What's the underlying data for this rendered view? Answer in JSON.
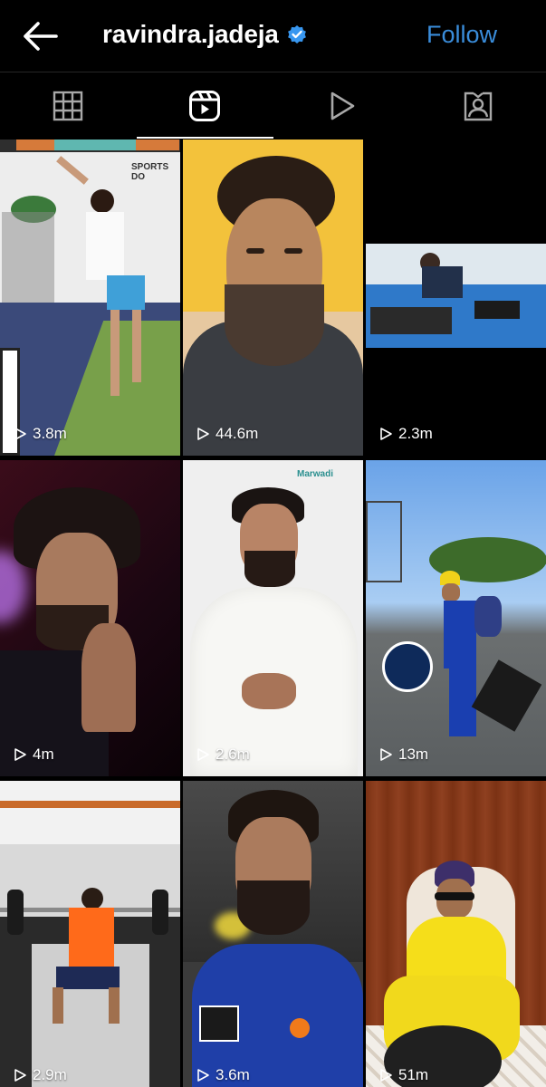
{
  "header": {
    "username": "ravindra.jadeja",
    "follow_label": "Follow",
    "back_icon": "arrow-left-icon",
    "verified_icon": "verified-badge-icon",
    "verified_color": "#3897f0",
    "follow_color": "#3a8ddb"
  },
  "tabs": [
    {
      "name": "grid",
      "icon": "grid-icon",
      "active": false
    },
    {
      "name": "reels",
      "icon": "reels-icon",
      "active": true
    },
    {
      "name": "videos",
      "icon": "play-icon",
      "active": false
    },
    {
      "name": "tagged",
      "icon": "tagged-person-icon",
      "active": false
    }
  ],
  "reels": [
    {
      "views": "3.8m",
      "subject": "gym-workout"
    },
    {
      "views": "44.6m",
      "subject": "portrait-selfie"
    },
    {
      "views": "2.3m",
      "subject": "gym-machine"
    },
    {
      "views": "4m",
      "subject": "portrait-namaste"
    },
    {
      "views": "2.6m",
      "subject": "university-video"
    },
    {
      "views": "13m",
      "subject": "cricket-kit"
    },
    {
      "views": "2.9m",
      "subject": "weightlifting"
    },
    {
      "views": "3.6m",
      "subject": "team-jersey"
    },
    {
      "views": "51m",
      "subject": "yellow-jersey"
    }
  ],
  "overlay_text": {
    "gym_sign": "SPORTS DO",
    "university_logo": "Marwadi"
  }
}
